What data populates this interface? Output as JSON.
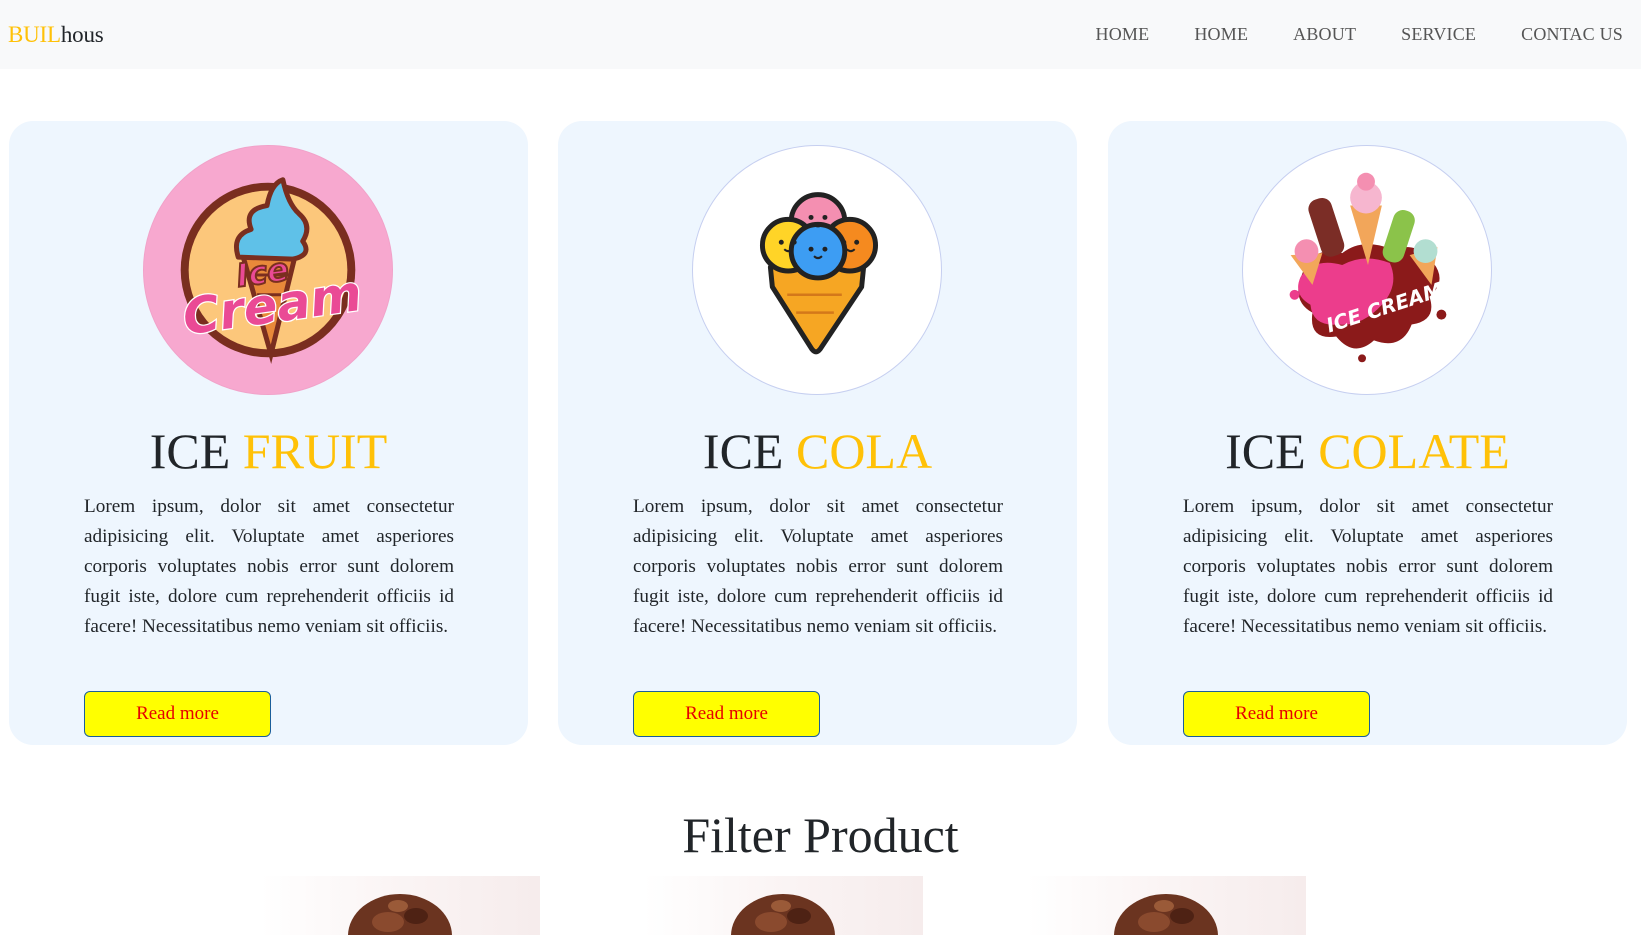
{
  "navbar": {
    "brand_part1": "BUIL",
    "brand_part2": "hous",
    "links": [
      "HOME",
      "HOME",
      "ABOUT",
      "SERVICE",
      "CONTAC US"
    ]
  },
  "cards": [
    {
      "title_part1": "ICE ",
      "title_part2": "FRUIT",
      "logo_text1": "Ice",
      "logo_text2": "Cream",
      "text": "Lorem ipsum, dolor sit amet consectetur adipisicing elit. Voluptate amet asperiores corporis voluptates nobis error sunt dolorem fugit iste, dolore cum reprehenderit officiis id facere! Necessitatibus nemo veniam sit officiis.",
      "button": "Read more"
    },
    {
      "title_part1": "ICE ",
      "title_part2": "COLA",
      "text": "Lorem ipsum, dolor sit amet consectetur adipisicing elit. Voluptate amet asperiores corporis voluptates nobis error sunt dolorem fugit iste, dolore cum reprehenderit officiis id facere! Necessitatibus nemo veniam sit officiis.",
      "button": "Read more"
    },
    {
      "title_part1": "ICE ",
      "title_part2": "COLATE",
      "logo_text": "ICE CREAM",
      "text": "Lorem ipsum, dolor sit amet consectetur adipisicing elit. Voluptate amet asperiores corporis voluptates nobis error sunt dolorem fugit iste, dolore cum reprehenderit officiis id facere! Necessitatibus nemo veniam sit officiis.",
      "button": "Read more"
    }
  ],
  "section_title": "Filter Product",
  "colors": {
    "accent": "#ffc107",
    "card_bg": "#eef6fe",
    "button_bg": "#ffff00",
    "button_text": "#e60000",
    "nav_bg": "#f8f9fa"
  },
  "icons": {
    "card1": "ice-cream-badge-logo",
    "card2": "ice-cream-cone-three-scoops-icon",
    "card3": "ice-cream-splash-logo",
    "products": "chocolate-ice-cream-scoop-image"
  }
}
